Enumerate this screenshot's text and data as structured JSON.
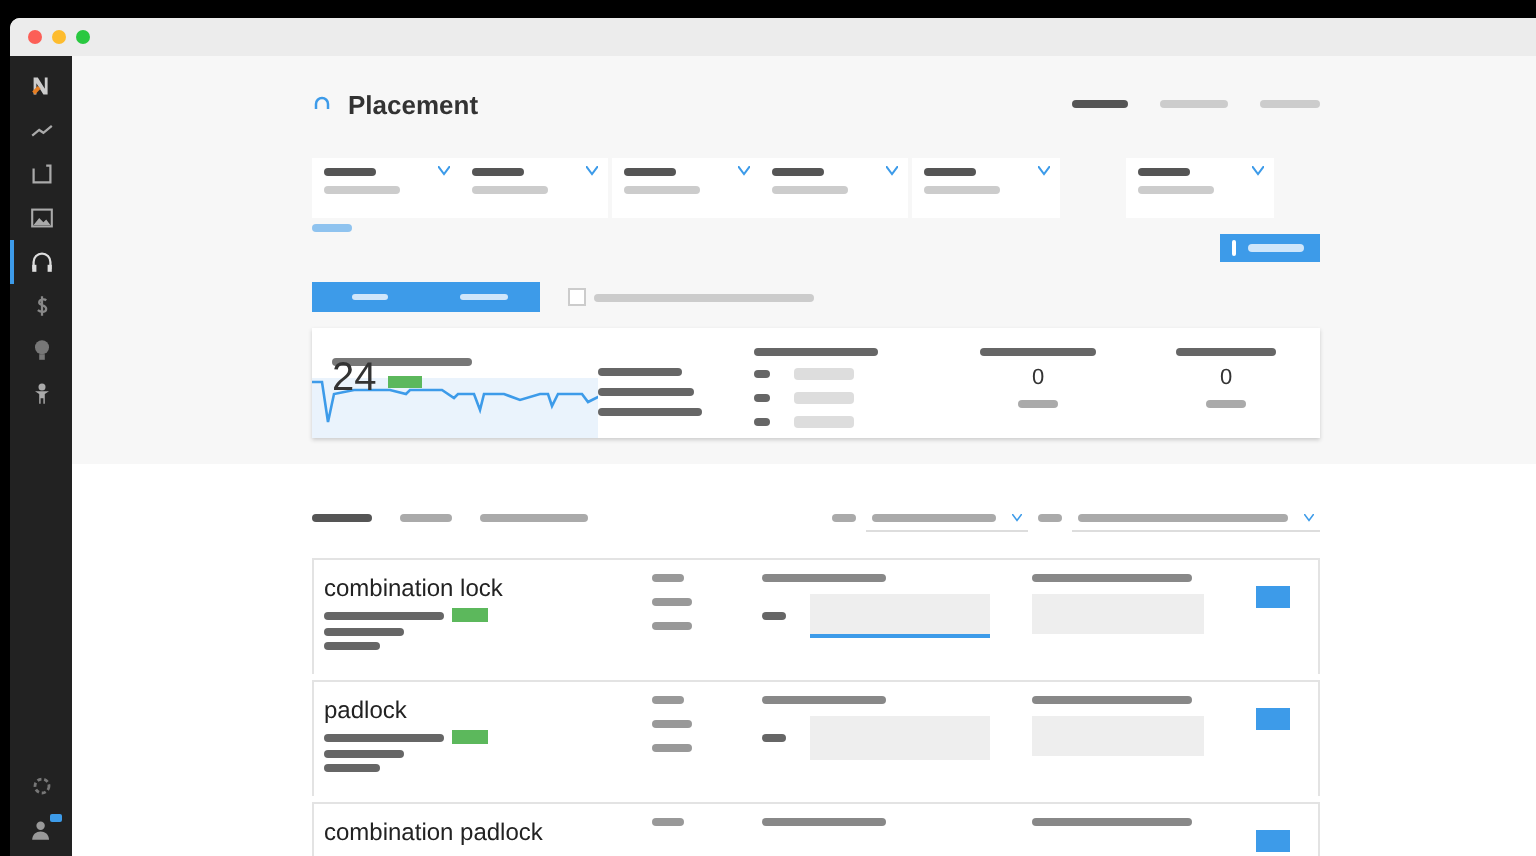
{
  "sidebar": {
    "items": [
      {
        "kind": "logo",
        "selected": false
      },
      {
        "kind": "trend",
        "selected": false
      },
      {
        "kind": "box",
        "selected": false
      },
      {
        "kind": "image",
        "selected": false
      },
      {
        "kind": "headphones",
        "selected": true
      },
      {
        "kind": "dollar",
        "selected": false
      },
      {
        "kind": "bulb",
        "selected": false
      },
      {
        "kind": "person",
        "selected": false
      }
    ],
    "bottom_items": [
      {
        "kind": "gear",
        "badge": false
      },
      {
        "kind": "user",
        "badge": true
      }
    ]
  },
  "header": {
    "title": "Placement",
    "tabs": [
      {
        "selected": true
      },
      {
        "selected": false
      },
      {
        "selected": false
      }
    ]
  },
  "filter_groups": [
    {
      "fields": [
        {
          "kind": "dropdown"
        },
        {
          "kind": "dropdown"
        }
      ]
    },
    {
      "fields": [
        {
          "kind": "dropdown"
        },
        {
          "kind": "dropdown"
        }
      ]
    },
    {
      "fields": [
        {
          "kind": "dropdown"
        }
      ]
    },
    {
      "fields": [
        {
          "kind": "dropdown"
        }
      ]
    }
  ],
  "view_toggle": [
    {
      "selected": true
    },
    {
      "selected": true
    }
  ],
  "option_checkbox": {
    "checked": false
  },
  "stats": {
    "score": "24",
    "counts": [
      "0",
      "0"
    ],
    "rows": [
      {
        "kind": "metric"
      },
      {
        "kind": "metric"
      },
      {
        "kind": "metric"
      }
    ]
  },
  "result_tabs": [
    {
      "selected": true
    },
    {
      "selected": false
    },
    {
      "selected": false
    }
  ],
  "results": [
    {
      "kind": "full",
      "title": "combination lock",
      "highlighted": true
    },
    {
      "kind": "full",
      "title": "padlock",
      "highlighted": false
    },
    {
      "kind": "partial",
      "title": "combination padlock"
    }
  ]
}
